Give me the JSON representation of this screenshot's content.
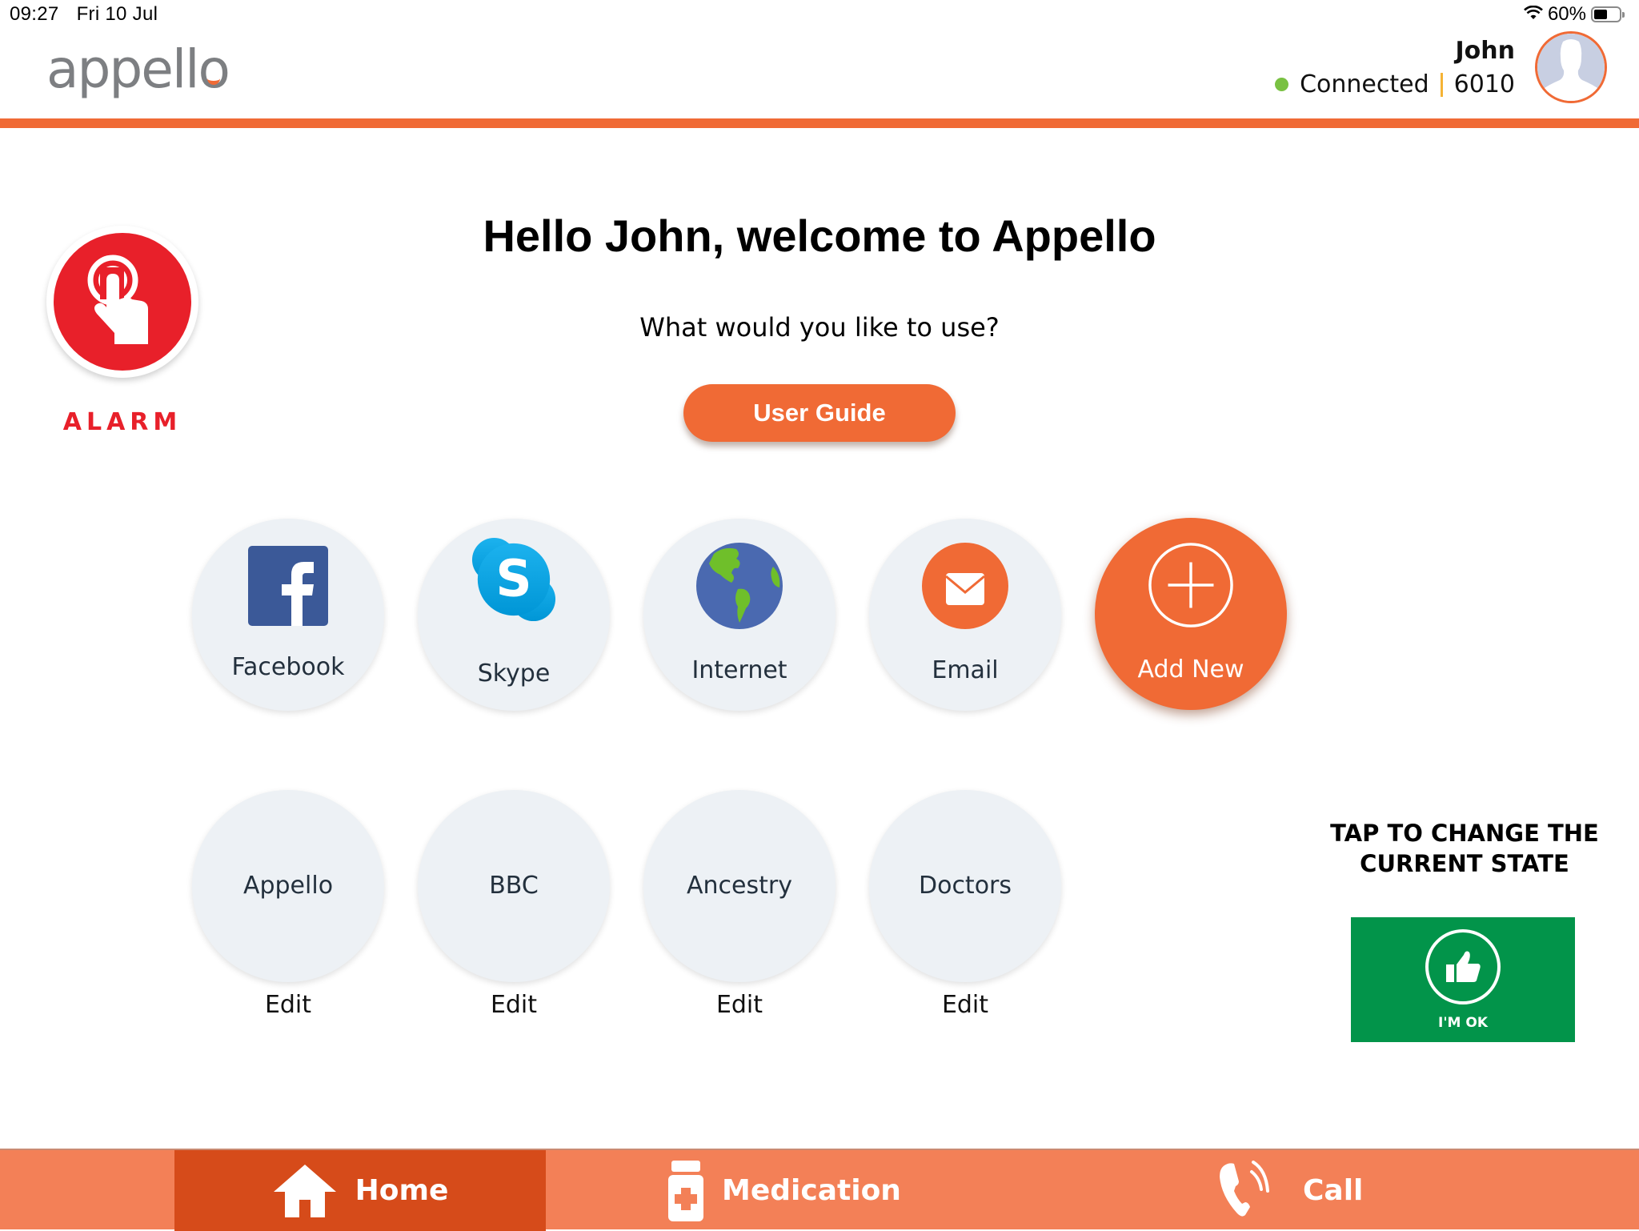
{
  "status_bar": {
    "time": "09:27",
    "date": "Fri 10 Jul",
    "battery_percent_label": "60%",
    "battery_level": 0.6,
    "wifi_icon": "wifi-icon"
  },
  "header": {
    "logo_text": "appello",
    "user_name": "John",
    "connection_status": "Connected",
    "connection_color": "#79c142",
    "user_id": "6010",
    "avatar_icon": "person-silhouette-icon"
  },
  "alarm": {
    "label": "ALARM",
    "icon": "tap-hand-icon",
    "color": "#e8202a"
  },
  "main": {
    "welcome": "Hello John, welcome to Appello",
    "prompt": "What would you like to use?",
    "user_guide_label": "User Guide"
  },
  "apps_row1": [
    {
      "label": "Facebook",
      "icon": "facebook-icon"
    },
    {
      "label": "Skype",
      "icon": "skype-icon"
    },
    {
      "label": "Internet",
      "icon": "globe-icon"
    },
    {
      "label": "Email",
      "icon": "envelope-icon"
    },
    {
      "label": "Add New",
      "icon": "plus-circle-icon"
    }
  ],
  "apps_row2": [
    {
      "label": "Appello",
      "edit": "Edit"
    },
    {
      "label": "BBC",
      "edit": "Edit"
    },
    {
      "label": "Ancestry",
      "edit": "Edit"
    },
    {
      "label": "Doctors",
      "edit": "Edit"
    }
  ],
  "state_panel": {
    "title_line1": "TAP TO CHANGE THE",
    "title_line2": "CURRENT STATE",
    "state_label": "I'M OK",
    "state_icon": "thumbs-up-icon",
    "state_color": "#02944a"
  },
  "bottom_nav": [
    {
      "label": "Home",
      "icon": "home-icon",
      "active": true
    },
    {
      "label": "Medication",
      "icon": "medicine-bottle-icon",
      "active": false
    },
    {
      "label": "Call",
      "icon": "phone-ringing-icon",
      "active": false
    }
  ],
  "colors": {
    "accent": "#f06a35",
    "nav_bg": "#f38057",
    "nav_active": "#d64b1a",
    "tile_bg": "#edf1f5"
  }
}
